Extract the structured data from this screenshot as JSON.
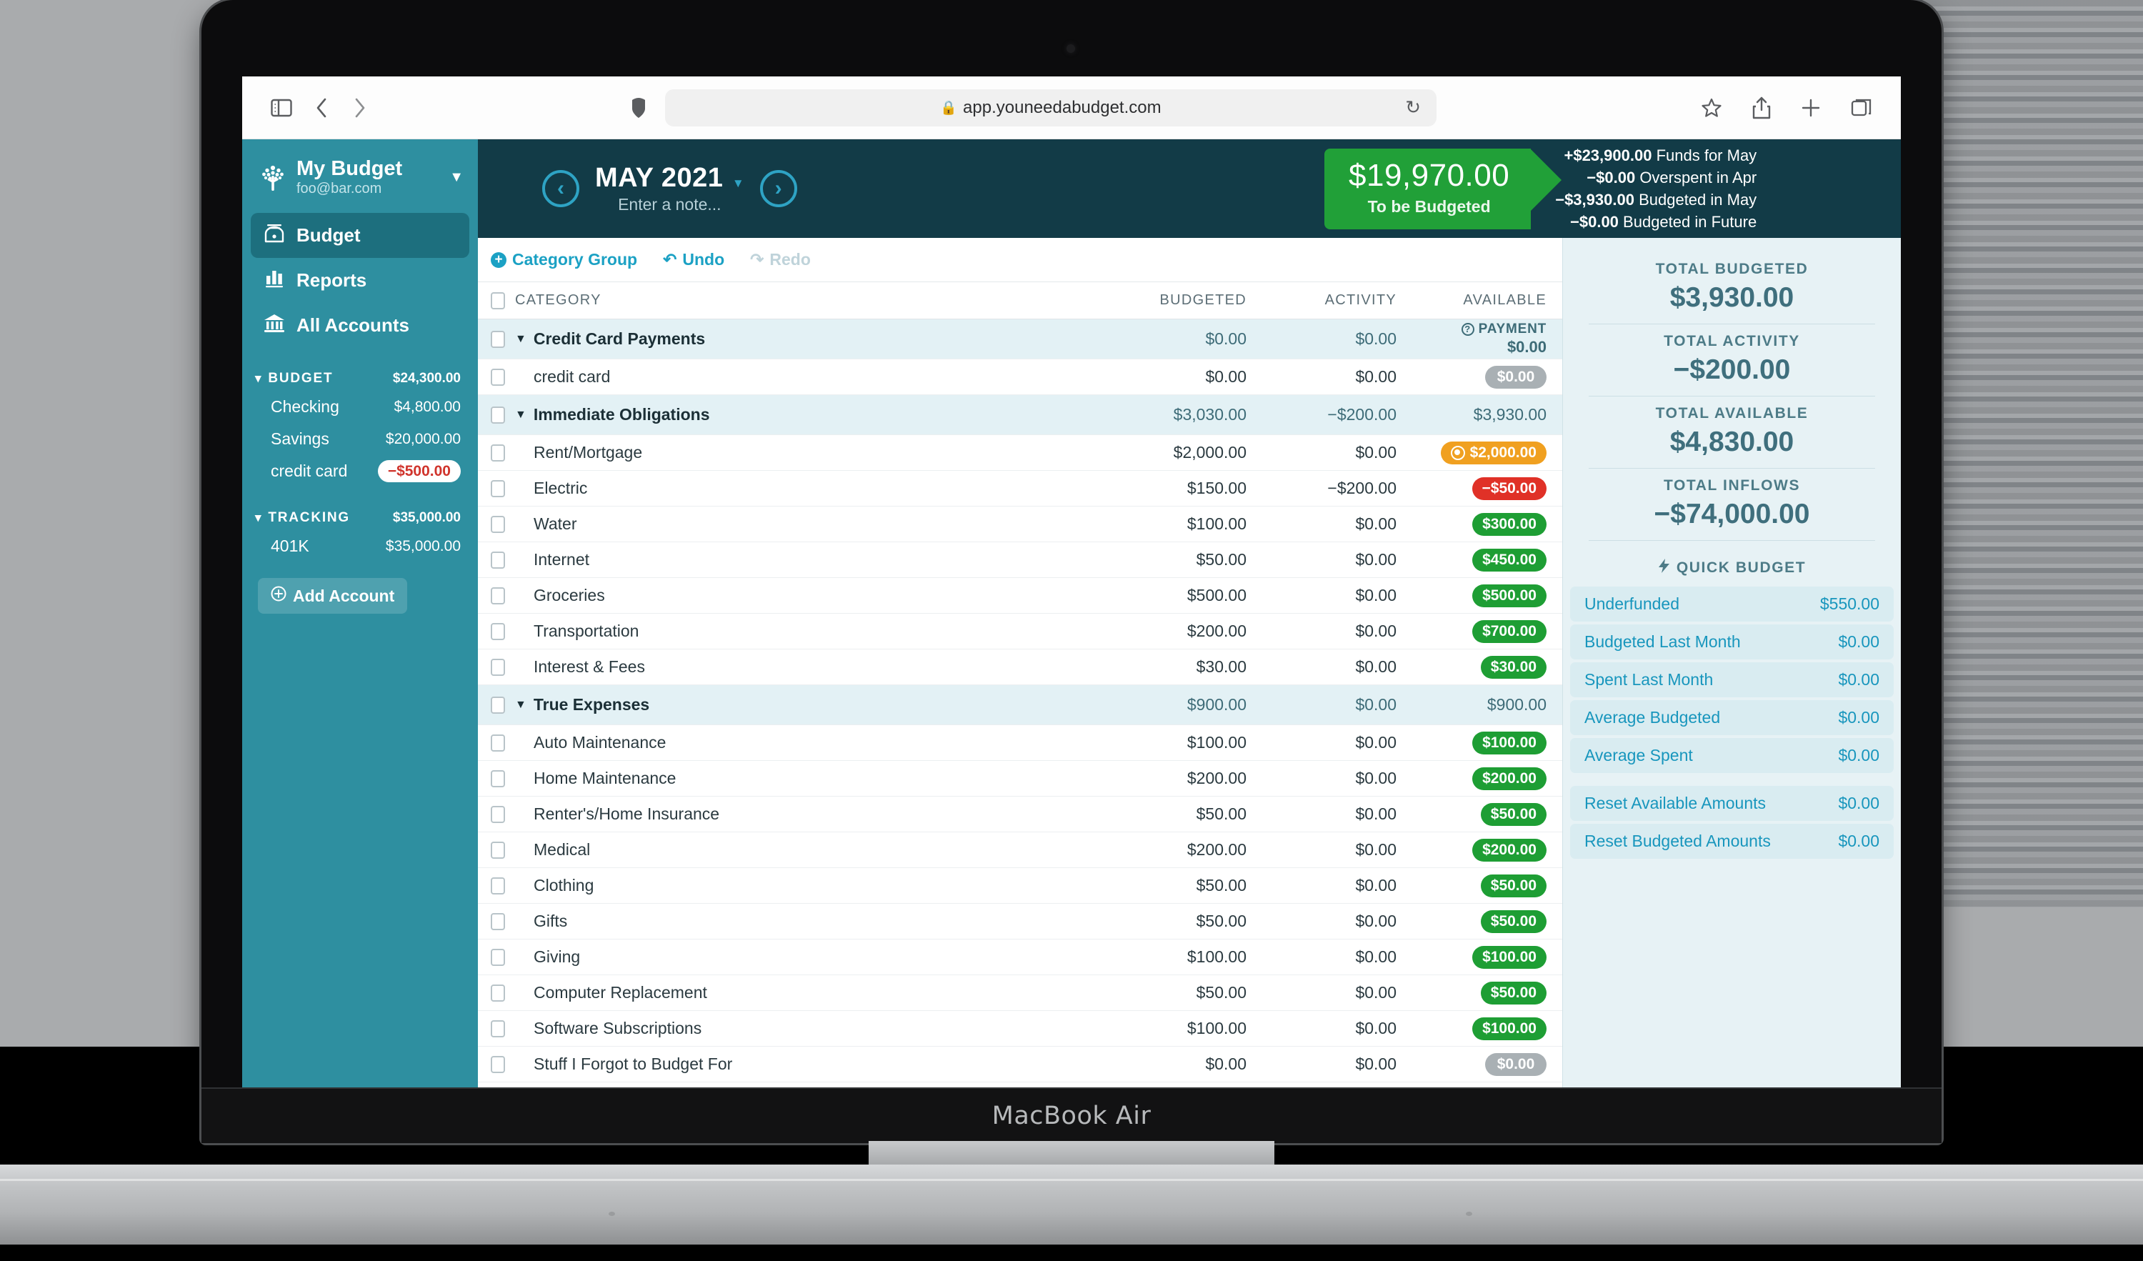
{
  "device": {
    "label": "MacBook Air"
  },
  "browser": {
    "url": "app.youneedabudget.com",
    "icons": {
      "sidebar_toggle": "sidebar-toggle-icon",
      "back": "back-arrow-icon",
      "forward": "forward-arrow-icon",
      "shield": "shield-icon",
      "lock": "lock-icon",
      "reload": "reload-icon",
      "bookmark": "star-icon",
      "share": "share-icon",
      "new_tab": "plus-icon",
      "tabs": "tabs-icon"
    }
  },
  "sidebar": {
    "budget_name": "My Budget",
    "email": "foo@bar.com",
    "nav": [
      {
        "label": "Budget",
        "icon": "budget-icon",
        "active": true
      },
      {
        "label": "Reports",
        "icon": "reports-bar-chart-icon",
        "active": false
      },
      {
        "label": "All Accounts",
        "icon": "bank-icon",
        "active": false
      }
    ],
    "groups": [
      {
        "name": "BUDGET",
        "total": "$24,300.00",
        "accounts": [
          {
            "name": "Checking",
            "amount": "$4,800.00",
            "negative": false
          },
          {
            "name": "Savings",
            "amount": "$20,000.00",
            "negative": false
          },
          {
            "name": "credit card",
            "amount": "−$500.00",
            "negative": true
          }
        ]
      },
      {
        "name": "TRACKING",
        "total": "$35,000.00",
        "accounts": [
          {
            "name": "401K",
            "amount": "$35,000.00",
            "negative": false
          }
        ]
      }
    ],
    "add_account_label": "Add Account"
  },
  "topbar": {
    "month": "MAY 2021",
    "note_placeholder": "Enter a note...",
    "prev_icon": "chevron-left-icon",
    "next_icon": "chevron-right-icon",
    "to_be_budgeted": {
      "amount": "$19,970.00",
      "label": "To be Budgeted",
      "color": "#21a038"
    },
    "breakdown": [
      {
        "amount": "+$23,900.00",
        "label": "Funds for May"
      },
      {
        "amount": "−$0.00",
        "label": "Overspent in Apr"
      },
      {
        "amount": "−$3,930.00",
        "label": "Budgeted in May"
      },
      {
        "amount": "−$0.00",
        "label": "Budgeted in Future"
      }
    ]
  },
  "toolbar": {
    "category_group": "Category Group",
    "undo": "Undo",
    "redo": "Redo"
  },
  "table": {
    "headers": {
      "category": "CATEGORY",
      "budgeted": "BUDGETED",
      "activity": "ACTIVITY",
      "available": "AVAILABLE"
    },
    "rows": [
      {
        "type": "group",
        "name": "Credit Card Payments",
        "budgeted": "$0.00",
        "activity": "$0.00",
        "available": "$0.00",
        "available_kind": "payment",
        "payment_label": "PAYMENT"
      },
      {
        "type": "child",
        "name": "credit card",
        "budgeted": "$0.00",
        "activity": "$0.00",
        "available": "$0.00",
        "available_kind": "grey"
      },
      {
        "type": "group",
        "name": "Immediate Obligations",
        "budgeted": "$3,030.00",
        "activity": "−$200.00",
        "available": "$3,930.00",
        "available_kind": "plain"
      },
      {
        "type": "child",
        "name": "Rent/Mortgage",
        "budgeted": "$2,000.00",
        "activity": "$0.00",
        "available": "$2,000.00",
        "available_kind": "orange"
      },
      {
        "type": "child",
        "name": "Electric",
        "budgeted": "$150.00",
        "activity": "−$200.00",
        "available": "−$50.00",
        "available_kind": "red"
      },
      {
        "type": "child",
        "name": "Water",
        "budgeted": "$100.00",
        "activity": "$0.00",
        "available": "$300.00",
        "available_kind": "green"
      },
      {
        "type": "child",
        "name": "Internet",
        "budgeted": "$50.00",
        "activity": "$0.00",
        "available": "$450.00",
        "available_kind": "green"
      },
      {
        "type": "child",
        "name": "Groceries",
        "budgeted": "$500.00",
        "activity": "$0.00",
        "available": "$500.00",
        "available_kind": "green"
      },
      {
        "type": "child",
        "name": "Transportation",
        "budgeted": "$200.00",
        "activity": "$0.00",
        "available": "$700.00",
        "available_kind": "green"
      },
      {
        "type": "child",
        "name": "Interest & Fees",
        "budgeted": "$30.00",
        "activity": "$0.00",
        "available": "$30.00",
        "available_kind": "green"
      },
      {
        "type": "group",
        "name": "True Expenses",
        "budgeted": "$900.00",
        "activity": "$0.00",
        "available": "$900.00",
        "available_kind": "plain"
      },
      {
        "type": "child",
        "name": "Auto Maintenance",
        "budgeted": "$100.00",
        "activity": "$0.00",
        "available": "$100.00",
        "available_kind": "green"
      },
      {
        "type": "child",
        "name": "Home Maintenance",
        "budgeted": "$200.00",
        "activity": "$0.00",
        "available": "$200.00",
        "available_kind": "green"
      },
      {
        "type": "child",
        "name": "Renter's/Home Insurance",
        "budgeted": "$50.00",
        "activity": "$0.00",
        "available": "$50.00",
        "available_kind": "green"
      },
      {
        "type": "child",
        "name": "Medical",
        "budgeted": "$200.00",
        "activity": "$0.00",
        "available": "$200.00",
        "available_kind": "green"
      },
      {
        "type": "child",
        "name": "Clothing",
        "budgeted": "$50.00",
        "activity": "$0.00",
        "available": "$50.00",
        "available_kind": "green"
      },
      {
        "type": "child",
        "name": "Gifts",
        "budgeted": "$50.00",
        "activity": "$0.00",
        "available": "$50.00",
        "available_kind": "green"
      },
      {
        "type": "child",
        "name": "Giving",
        "budgeted": "$100.00",
        "activity": "$0.00",
        "available": "$100.00",
        "available_kind": "green"
      },
      {
        "type": "child",
        "name": "Computer Replacement",
        "budgeted": "$50.00",
        "activity": "$0.00",
        "available": "$50.00",
        "available_kind": "green"
      },
      {
        "type": "child",
        "name": "Software Subscriptions",
        "budgeted": "$100.00",
        "activity": "$0.00",
        "available": "$100.00",
        "available_kind": "green"
      },
      {
        "type": "child",
        "name": "Stuff I Forgot to Budget For",
        "budgeted": "$0.00",
        "activity": "$0.00",
        "available": "$0.00",
        "available_kind": "grey"
      }
    ]
  },
  "inspector": {
    "totals": [
      {
        "label": "TOTAL BUDGETED",
        "value": "$3,930.00"
      },
      {
        "label": "TOTAL ACTIVITY",
        "value": "−$200.00"
      },
      {
        "label": "TOTAL AVAILABLE",
        "value": "$4,830.00"
      },
      {
        "label": "TOTAL INFLOWS",
        "value": "−$74,000.00"
      }
    ],
    "quick_budget": {
      "title": "QUICK BUDGET",
      "icon": "lightning-bolt-icon",
      "items": [
        {
          "label": "Underfunded",
          "value": "$550.00",
          "spaced": false
        },
        {
          "label": "Budgeted Last Month",
          "value": "$0.00",
          "spaced": false
        },
        {
          "label": "Spent Last Month",
          "value": "$0.00",
          "spaced": false
        },
        {
          "label": "Average Budgeted",
          "value": "$0.00",
          "spaced": false
        },
        {
          "label": "Average Spent",
          "value": "$0.00",
          "spaced": false
        },
        {
          "label": "Reset Available Amounts",
          "value": "$0.00",
          "spaced": true
        },
        {
          "label": "Reset Budgeted Amounts",
          "value": "$0.00",
          "spaced": false
        }
      ]
    }
  }
}
